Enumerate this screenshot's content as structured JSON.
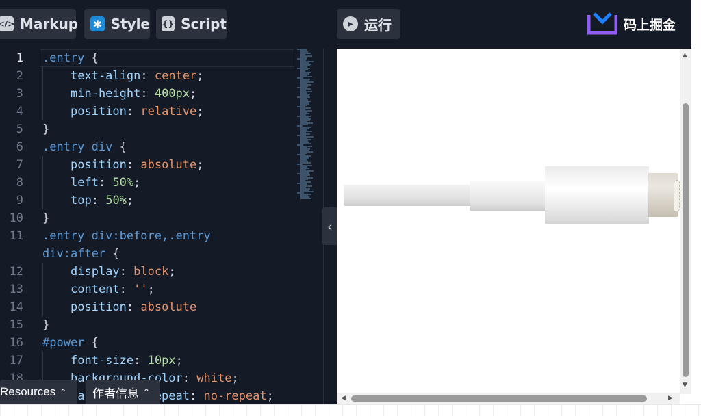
{
  "toolbar": {
    "markup_label": "Markup",
    "markup_icon": "</>",
    "style_label": "Style",
    "style_icon": "✱",
    "script_label": "Script",
    "script_icon": "{}",
    "run_label": "运行",
    "run_icon": "▶"
  },
  "brand": {
    "name": "码上掘金",
    "accent_color": "#8f5cf7"
  },
  "editor": {
    "active_line": 1,
    "lines": [
      {
        "n": "1",
        "tokens": [
          [
            ".entry ",
            "sel"
          ],
          [
            "{",
            "pun"
          ]
        ]
      },
      {
        "n": "2",
        "tokens": [
          [
            "text-align",
            "prop"
          ],
          [
            ": ",
            "pun"
          ],
          [
            "center",
            "val"
          ],
          [
            ";",
            "pun"
          ]
        ]
      },
      {
        "n": "3",
        "tokens": [
          [
            "min-height",
            "prop"
          ],
          [
            ": ",
            "pun"
          ],
          [
            "400px",
            "num"
          ],
          [
            ";",
            "pun"
          ]
        ]
      },
      {
        "n": "4",
        "tokens": [
          [
            "position",
            "prop"
          ],
          [
            ": ",
            "pun"
          ],
          [
            "relative",
            "val"
          ],
          [
            ";",
            "pun"
          ]
        ]
      },
      {
        "n": "5",
        "tokens": [
          [
            "}",
            "pun"
          ]
        ]
      },
      {
        "n": "6",
        "tokens": [
          [
            ".entry div ",
            "sel"
          ],
          [
            "{",
            "pun"
          ]
        ]
      },
      {
        "n": "7",
        "tokens": [
          [
            "position",
            "prop"
          ],
          [
            ": ",
            "pun"
          ],
          [
            "absolute",
            "val"
          ],
          [
            ";",
            "pun"
          ]
        ]
      },
      {
        "n": "8",
        "tokens": [
          [
            "left",
            "prop"
          ],
          [
            ": ",
            "pun"
          ],
          [
            "50%",
            "num"
          ],
          [
            ";",
            "pun"
          ]
        ]
      },
      {
        "n": "9",
        "tokens": [
          [
            "top",
            "prop"
          ],
          [
            ": ",
            "pun"
          ],
          [
            "50%",
            "num"
          ],
          [
            ";",
            "pun"
          ]
        ]
      },
      {
        "n": "10",
        "tokens": [
          [
            "}",
            "pun"
          ]
        ]
      },
      {
        "n": "11",
        "tokens": [
          [
            ".entry div:before,.entry",
            "sel"
          ]
        ]
      },
      {
        "n": "",
        "tokens": [
          [
            "div:after ",
            "sel"
          ],
          [
            "{",
            "pun"
          ]
        ]
      },
      {
        "n": "12",
        "tokens": [
          [
            "display",
            "prop"
          ],
          [
            ": ",
            "pun"
          ],
          [
            "block",
            "val"
          ],
          [
            ";",
            "pun"
          ]
        ]
      },
      {
        "n": "13",
        "tokens": [
          [
            "content",
            "prop"
          ],
          [
            ": ",
            "pun"
          ],
          [
            "''",
            "val"
          ],
          [
            ";",
            "pun"
          ]
        ]
      },
      {
        "n": "14",
        "tokens": [
          [
            "position",
            "prop"
          ],
          [
            ": ",
            "pun"
          ],
          [
            "absolute",
            "val"
          ]
        ]
      },
      {
        "n": "15",
        "tokens": [
          [
            "}",
            "pun"
          ]
        ]
      },
      {
        "n": "16",
        "tokens": [
          [
            "#power ",
            "sel"
          ],
          [
            "{",
            "pun"
          ]
        ]
      },
      {
        "n": "17",
        "tokens": [
          [
            "font-size",
            "prop"
          ],
          [
            ": ",
            "pun"
          ],
          [
            "10px",
            "num"
          ],
          [
            ";",
            "pun"
          ]
        ]
      },
      {
        "n": "18",
        "tokens": [
          [
            "background-color",
            "prop"
          ],
          [
            ": ",
            "pun"
          ],
          [
            "white",
            "val"
          ],
          [
            ";",
            "pun"
          ]
        ]
      },
      {
        "n": "",
        "tokens": [
          [
            "background-repeat",
            "prop"
          ],
          [
            ": ",
            "pun"
          ],
          [
            "no-repeat",
            "val"
          ],
          [
            ";",
            "pun"
          ]
        ]
      }
    ]
  },
  "bottom_bar": {
    "resources_label": "Resources",
    "author_label": "作者信息",
    "caret": "⌃"
  },
  "splitter": {
    "label": "‹›"
  },
  "preview": {
    "scroll_up": "▲",
    "scroll_down": "▼",
    "scroll_left": "◀",
    "scroll_right": "▶"
  }
}
